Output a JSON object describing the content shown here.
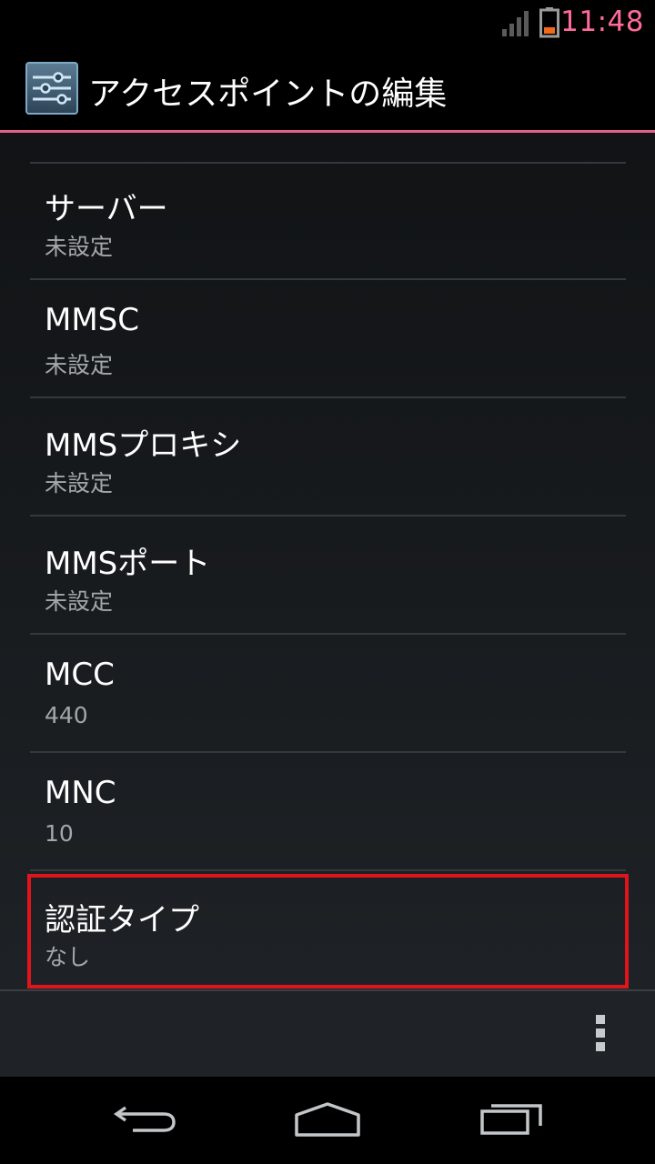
{
  "status_bar": {
    "time": "11:48",
    "icons": [
      "signal-icon",
      "battery-icon"
    ],
    "time_color": "#ff6b9a"
  },
  "action_bar": {
    "title": "アクセスポイントの編集",
    "icon": "settings-sliders-icon",
    "accent_color": "#e3608c"
  },
  "preferences": [
    {
      "title": "サーバー",
      "summary": "未設定"
    },
    {
      "title": "MMSC",
      "summary": "未設定"
    },
    {
      "title": "MMSプロキシ",
      "summary": "未設定"
    },
    {
      "title": "MMSポート",
      "summary": "未設定"
    },
    {
      "title": "MCC",
      "summary": "440"
    },
    {
      "title": "MNC",
      "summary": "10"
    },
    {
      "title": "認証タイプ",
      "summary": "なし"
    }
  ],
  "bottom_bar": {
    "icons": [
      "overflow-menu-icon"
    ]
  },
  "nav_bar": {
    "icons": [
      "back-icon",
      "home-icon",
      "recent-apps-icon"
    ]
  },
  "highlight_color": "#e0151c"
}
